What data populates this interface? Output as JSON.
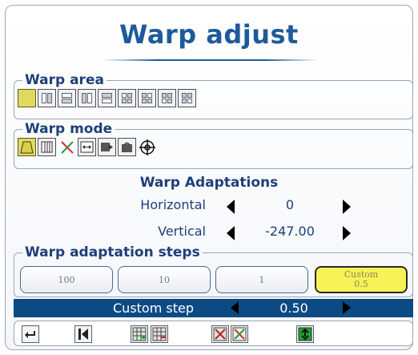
{
  "title": "Warp adjust",
  "warp_area": {
    "legend": "Warp area",
    "buttons": [
      {
        "icon": "full-area-icon",
        "selected": true
      },
      {
        "icon": "left-half-area-icon",
        "selected": false
      },
      {
        "icon": "top-half-area-icon",
        "selected": false
      },
      {
        "icon": "right-half-area-icon",
        "selected": false
      },
      {
        "icon": "bottom-half-area-icon",
        "selected": false
      },
      {
        "icon": "top-left-quarter-icon",
        "selected": false
      },
      {
        "icon": "top-right-quarter-icon",
        "selected": false
      },
      {
        "icon": "bottom-left-quarter-icon",
        "selected": false
      },
      {
        "icon": "bottom-right-quarter-icon",
        "selected": false
      }
    ]
  },
  "warp_mode": {
    "legend": "Warp mode",
    "buttons": [
      {
        "icon": "keystone-icon",
        "selected": true
      },
      {
        "icon": "vertical-lines-icon",
        "selected": false
      },
      {
        "icon": "corner-cross-icon",
        "selected": false
      },
      {
        "icon": "horizontal-stretch-icon",
        "selected": false
      },
      {
        "icon": "shift-right-icon",
        "selected": false
      },
      {
        "icon": "rotate-icon",
        "selected": false
      },
      {
        "icon": "crosshair-icon",
        "selected": false
      }
    ]
  },
  "adaptations": {
    "title": "Warp Adaptations",
    "horizontal_label": "Horizontal",
    "horizontal_value": "0",
    "vertical_label": "Vertical",
    "vertical_value": "-247.00"
  },
  "steps": {
    "legend": "Warp adaptation steps",
    "step_100": "100",
    "step_10": "10",
    "step_1": "1",
    "custom_label": "Custom",
    "custom_value": "0.5"
  },
  "custom_step": {
    "label": "Custom step",
    "value": "0.50"
  },
  "toolbar": {
    "buttons": [
      "back-icon",
      "reset-to-start-icon",
      "add-grid-point-icon",
      "remove-grid-point-icon",
      "clear-grid-icon",
      "clear-all-icon",
      "apply-icon"
    ]
  },
  "colors": {
    "accent": "#1e5a9a",
    "label": "#1e3f78",
    "selected": "#e1d860",
    "custom_bar": "#0c4a84"
  }
}
